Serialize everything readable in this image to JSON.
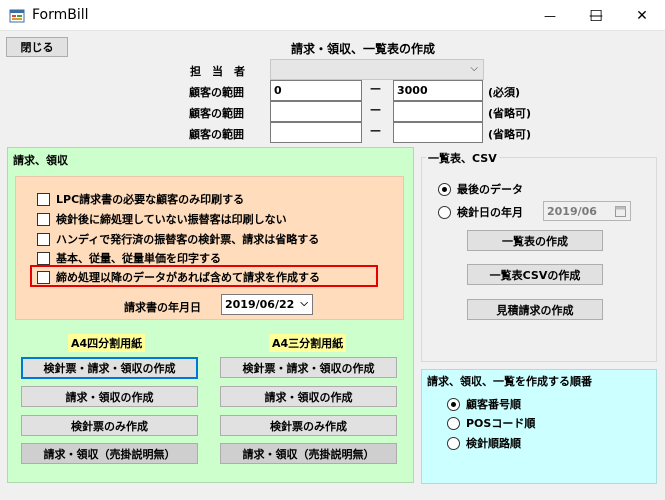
{
  "window": {
    "title": "FormBill",
    "minimize_glyph": "—",
    "maximize_glyph": "☐",
    "close_glyph": "✕"
  },
  "toolbar": {
    "close_label": "閉じる"
  },
  "header": {
    "title": "請求・領収、一覧表の作成"
  },
  "person": {
    "label": "担　当　者",
    "value": ""
  },
  "ranges": [
    {
      "label": "顧客の範囲",
      "from": "0",
      "dash": "—",
      "to": "3000",
      "note": "(必須)"
    },
    {
      "label": "顧客の範囲",
      "from": "",
      "dash": "—",
      "to": "",
      "note": "(省略可)"
    },
    {
      "label": "顧客の範囲",
      "from": "",
      "dash": "—",
      "to": "",
      "note": "(省略可)"
    }
  ],
  "billing": {
    "title": "請求、領収",
    "options": [
      {
        "label": "LPC請求書の必要な顧客のみ印刷する",
        "checked": false
      },
      {
        "label": "検針後に締処理していない振替客は印刷しない",
        "checked": false
      },
      {
        "label": "ハンディで発行済の振替客の検針票、請求は省略する",
        "checked": false
      },
      {
        "label": "基本、従量、従量単価を印字する",
        "checked": false
      },
      {
        "label": "締め処理以降のデータがあれば含めて請求を作成する",
        "checked": false
      }
    ],
    "date_label": "請求書の年月日",
    "date_value": "2019/06/22",
    "a4_label": "A4四分割用紙",
    "a3_label": "A4三分割用紙",
    "a4_buttons": [
      "検針票・請求・領収の作成",
      "請求・領収の作成",
      "検針票のみ作成",
      "請求・領収（売掛説明無）"
    ],
    "a3_buttons": [
      "検針票・請求・領収の作成",
      "請求・領収の作成",
      "検針票のみ作成",
      "請求・領収（売掛説明無）"
    ]
  },
  "list": {
    "title": "一覧表、CSV",
    "radio_last": "最後のデータ",
    "radio_month": "検針日の年月",
    "month_value": "2019/06",
    "buttons": [
      "一覧表の作成",
      "一覧表CSVの作成",
      "見積請求の作成"
    ]
  },
  "order": {
    "title": "請求、領収、一覧を作成する順番",
    "options": [
      {
        "label": "顧客番号順",
        "selected": true
      },
      {
        "label": "POSコード順",
        "selected": false
      },
      {
        "label": "検針順路順",
        "selected": false
      }
    ]
  }
}
